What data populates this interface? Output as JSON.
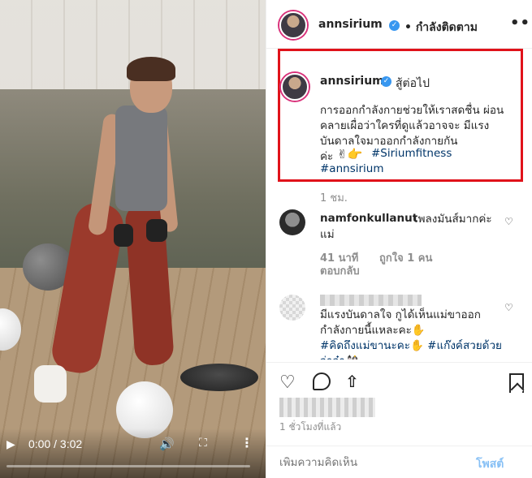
{
  "video": {
    "time": "0:00 / 3:02",
    "play_icon": "play-icon",
    "progress": 0
  },
  "header": {
    "username": "annsirium",
    "follow_status": "• กำลังติดตาม",
    "more": "•••"
  },
  "caption": {
    "username": "annsirium",
    "title": "สู้ต่อไป",
    "text": "การออกกำลังกายช่วยให้เราสดชื่น ผ่อนคลายเผื่อว่าใครที่ดูแล้วอาจจะ มีแรงบันดาลใจมาออกกำลังกายกัน",
    "text_end": "ค่ะ",
    "emoji": "✌👉",
    "tag1": "#Siriumfitness",
    "tag2": "#annsirium",
    "time": "1 ชม."
  },
  "comments": [
    {
      "username": "namfonkullanut",
      "text": "เพลงมันส์มากค่ะแม่",
      "time": "41 นาที",
      "likes": "ถูกใจ 1 คน",
      "reply": "ตอบกลับ"
    },
    {
      "username": "",
      "text": "มีแรงบันดาลใจ กูได้เห็นแม่ขาออกกำลังกายนี้แหละคะ✋",
      "tags": "#คิดถึงแม่ขานะคะ✋ #แก๊งค์สวยด้วยจ่าจ๋า🎎"
    }
  ],
  "actions": {
    "posted": "1 ชั่วโมงที่แล้ว"
  },
  "add_comment": {
    "placeholder": "เพิ่มความคิดเห็น",
    "post_label": "โพสต์"
  },
  "colors": {
    "accent": "#3897f0",
    "highlight_border": "#e0121a",
    "link": "#003569"
  }
}
